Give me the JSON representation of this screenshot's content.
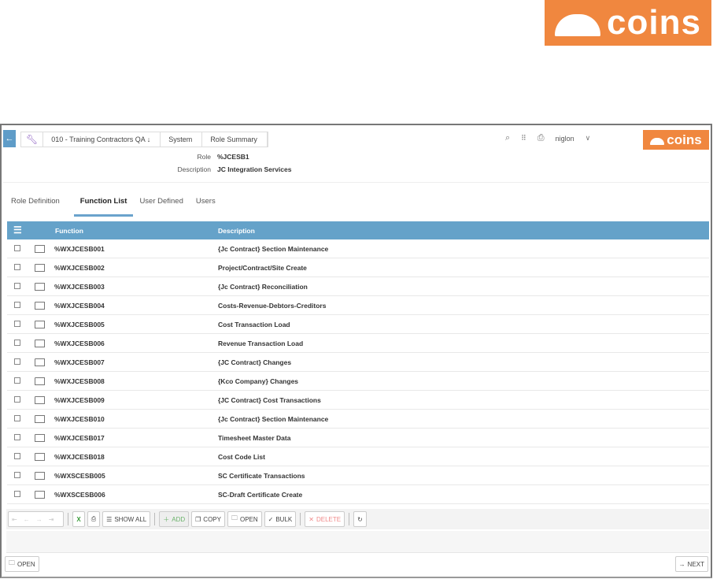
{
  "brand": {
    "logo_text": "coins",
    "color": "#f0873f",
    "accent": "#65a2c9"
  },
  "header": {
    "breadcrumbs": [
      "010 - Training Contractors QA ↓",
      "System",
      "Role Summary"
    ],
    "user": "niglon",
    "icons": [
      "search-icon",
      "apps-grid-icon",
      "print-icon",
      "chevron-down-icon"
    ]
  },
  "role": {
    "role_label": "Role",
    "role_value": "%JCESB1",
    "desc_label": "Description",
    "desc_value": "JC Integration Services"
  },
  "tabs": [
    {
      "label": "Role Definition"
    },
    {
      "label": "Function List",
      "active": true
    },
    {
      "label": "User Defined"
    },
    {
      "label": "Users"
    }
  ],
  "table": {
    "columns": [
      "Function",
      "Description"
    ],
    "rows": [
      {
        "function": "%WXJCESB001",
        "description": "{Jc Contract} Section Maintenance"
      },
      {
        "function": "%WXJCESB002",
        "description": "Project/Contract/Site Create"
      },
      {
        "function": "%WXJCESB003",
        "description": "{Jc Contract} Reconciliation"
      },
      {
        "function": "%WXJCESB004",
        "description": "Costs-Revenue-Debtors-Creditors"
      },
      {
        "function": "%WXJCESB005",
        "description": "Cost Transaction Load"
      },
      {
        "function": "%WXJCESB006",
        "description": "Revenue Transaction Load"
      },
      {
        "function": "%WXJCESB007",
        "description": "{JC Contract} Changes"
      },
      {
        "function": "%WXJCESB008",
        "description": "{Kco Company} Changes"
      },
      {
        "function": "%WXJCESB009",
        "description": "{JC Contract} Cost Transactions"
      },
      {
        "function": "%WXJCESB010",
        "description": "{Jc Contract} Section Maintenance"
      },
      {
        "function": "%WXJCESB017",
        "description": "Timesheet Master Data"
      },
      {
        "function": "%WXJCESB018",
        "description": "Cost Code List"
      },
      {
        "function": "%WXSCESB005",
        "description": "SC Certificate Transactions"
      },
      {
        "function": "%WXSCESB006",
        "description": "SC-Draft Certificate Create"
      }
    ]
  },
  "toolbar": {
    "show_all": "SHOW ALL",
    "add": "ADD",
    "copy": "COPY",
    "open": "OPEN",
    "bulk": "BULK",
    "delete": "DELETE"
  },
  "footer": {
    "open": "OPEN",
    "next": "NEXT"
  }
}
